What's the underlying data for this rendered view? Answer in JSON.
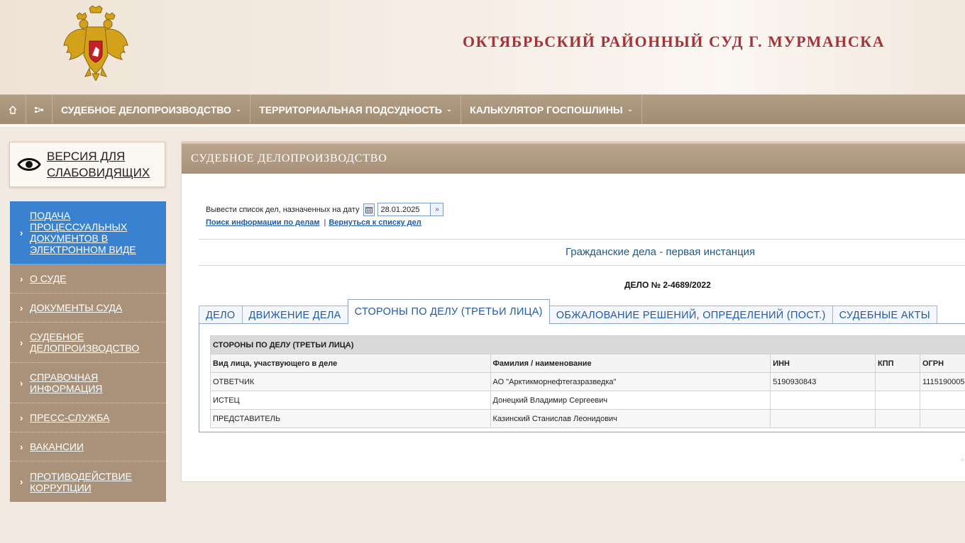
{
  "header": {
    "court_title": "ОКТЯБРЬСКИЙ РАЙОННЫЙ СУД Г. МУРМАНСКА"
  },
  "nav": {
    "home_icon": "home-icon",
    "sitemap_icon": "sitemap-icon",
    "items": [
      {
        "label": "СУДЕБНОЕ ДЕЛОПРОИЗВОДСТВО"
      },
      {
        "label": "ТЕРРИТОРИАЛЬНАЯ ПОДСУДНОСТЬ"
      },
      {
        "label": "КАЛЬКУЛЯТОР ГОСПОШЛИНЫ"
      }
    ]
  },
  "sidebar": {
    "vision": {
      "line1": "ВЕРСИЯ ДЛЯ",
      "line2": "СЛАБОВИДЯЩИХ"
    },
    "items": [
      {
        "label": "ПОДАЧА ПРОЦЕССУАЛЬНЫХ ДОКУМЕНТОВ В ЭЛЕКТРОННОМ ВИДЕ",
        "active": true
      },
      {
        "label": "О СУДЕ"
      },
      {
        "label": "ДОКУМЕНТЫ СУДА"
      },
      {
        "label": "СУДЕБНОЕ ДЕЛОПРОИЗВОДСТВО"
      },
      {
        "label": "СПРАВОЧНАЯ ИНФОРМАЦИЯ"
      },
      {
        "label": "ПРЕСС-СЛУЖБА"
      },
      {
        "label": "ВАКАНСИИ"
      },
      {
        "label": "ПРОТИВОДЕЙСТВИЕ КОРРУПЦИИ"
      }
    ]
  },
  "main": {
    "heading": "СУДЕБНОЕ ДЕЛОПРОИЗВОДСТВО",
    "date_label": "Вывести список дел, назначенных на дату",
    "date_value": "28.01.2025",
    "link_search": "Поиск информации по делам",
    "link_separator": "|",
    "link_back": "Вернуться к списку дел",
    "category": "Гражданские дела - первая инстанция",
    "case_number": "ДЕЛО № 2-4689/2022",
    "tabs": [
      {
        "label": "ДЕЛО"
      },
      {
        "label": "ДВИЖЕНИЕ ДЕЛА"
      },
      {
        "label": "СТОРОНЫ ПО ДЕЛУ (ТРЕТЬИ ЛИЦА)",
        "active": true
      },
      {
        "label": "ОБЖАЛОВАНИЕ РЕШЕНИЙ, ОПРЕДЕЛЕНИЙ (ПОСТ.)"
      },
      {
        "label": "СУДЕБНЫЕ АКТЫ"
      }
    ],
    "parties_table": {
      "caption": "СТОРОНЫ ПО ДЕЛУ (ТРЕТЬИ ЛИЦА)",
      "columns": [
        "Вид лица, участвующего в деле",
        "Фамилия / наименование",
        "ИНН",
        "КПП",
        "ОГРН"
      ],
      "rows": [
        [
          "ОТВЕТЧИК",
          "АО \"Арктикморнефтегазразведка\"",
          "5190930843",
          "",
          "1115190005"
        ],
        [
          "ИСТЕЦ",
          "Донецкий Владимир Сергеевич",
          "",
          "",
          ""
        ],
        [
          "ПРЕДСТАВИТЕЛЬ",
          "Казинский Станислав Леонидович",
          "",
          "",
          ""
        ]
      ]
    }
  },
  "colors": {
    "title_red": "#a3343a",
    "nav_brown": "#a8917a",
    "active_blue": "#3a82cf",
    "link_blue": "#1f5aa8"
  }
}
